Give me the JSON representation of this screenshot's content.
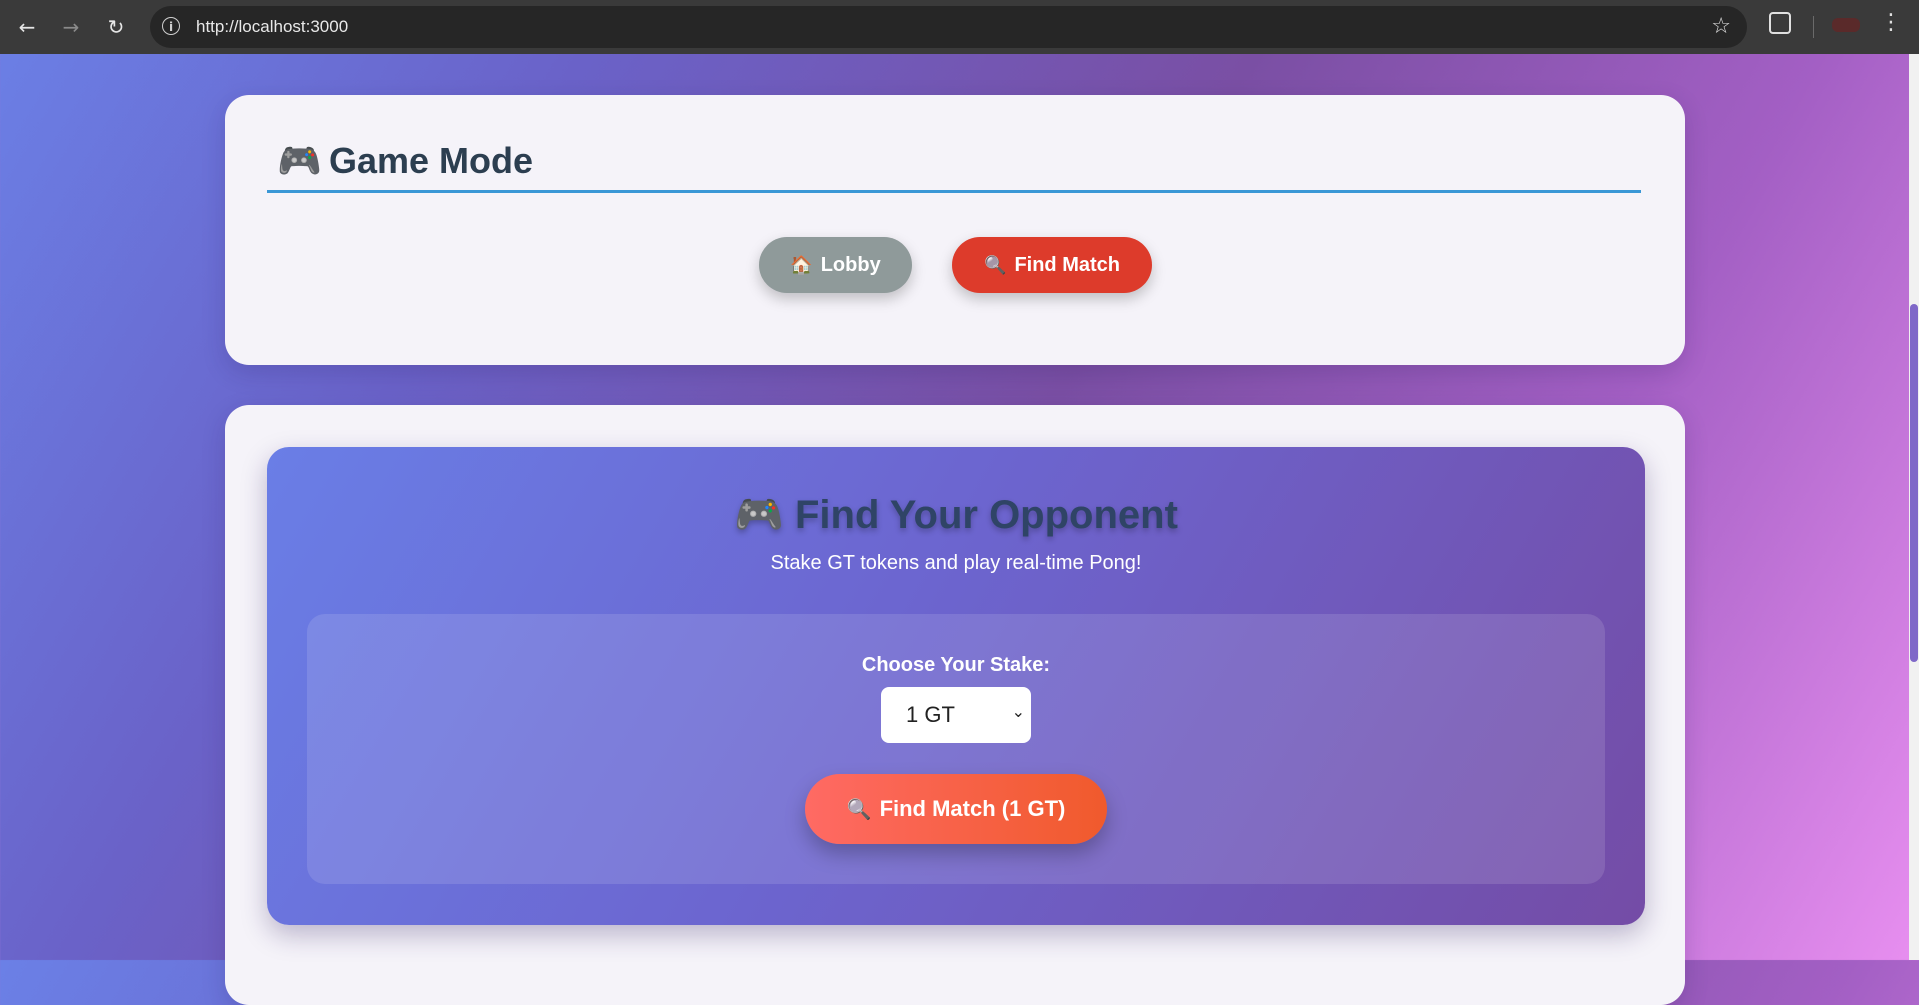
{
  "browser": {
    "url": "http://localhost:3000",
    "back_icon": "←",
    "forward_icon": "→",
    "reload_icon": "↻",
    "star_icon": "☆",
    "menu_icon": "⋮"
  },
  "game_mode": {
    "icon": "🎮",
    "title": "Game Mode",
    "buttons": {
      "lobby": {
        "icon": "🏠",
        "label": "Lobby"
      },
      "find_match": {
        "icon": "🔍",
        "label": "Find Match"
      }
    }
  },
  "opponent": {
    "icon": "🎮",
    "title": "Find Your Opponent",
    "subtitle": "Stake GT tokens and play real-time Pong!",
    "stake_label": "Choose Your Stake:",
    "stake_value": "1 GT",
    "cta_icon": "🔍",
    "cta_label": "Find Match (1 GT)"
  }
}
